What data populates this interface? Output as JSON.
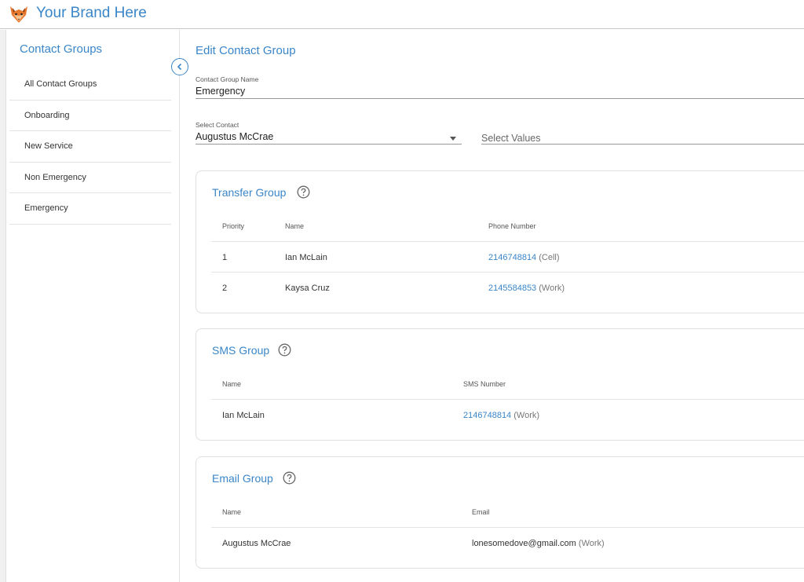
{
  "brand": {
    "name": "Your Brand Here",
    "logo_icon": "fox-icon"
  },
  "sidebar": {
    "title": "Contact Groups",
    "items": [
      {
        "label": "All Contact Groups"
      },
      {
        "label": "Onboarding"
      },
      {
        "label": "New Service"
      },
      {
        "label": "Non Emergency"
      },
      {
        "label": "Emergency"
      }
    ],
    "collapse_icon": "chevron-left-icon"
  },
  "main": {
    "title": "Edit Contact Group",
    "group_name": {
      "label": "Contact Group Name",
      "value": "Emergency"
    },
    "select_contact": {
      "label": "Select Contact",
      "value": "Augustus McCrae"
    },
    "select_values": {
      "placeholder": "Select Values"
    }
  },
  "transfer_group": {
    "title": "Transfer Group",
    "columns": {
      "priority": "Priority",
      "name": "Name",
      "phone": "Phone Number"
    },
    "rows": [
      {
        "priority": "1",
        "name": "Ian McLain",
        "number": "2146748814",
        "type": "(Cell)"
      },
      {
        "priority": "2",
        "name": "Kaysa Cruz",
        "number": "2145584853",
        "type": "(Work)"
      }
    ]
  },
  "sms_group": {
    "title": "SMS Group",
    "columns": {
      "name": "Name",
      "sms": "SMS Number"
    },
    "rows": [
      {
        "name": "Ian McLain",
        "number": "2146748814",
        "type": "(Work)"
      }
    ]
  },
  "email_group": {
    "title": "Email Group",
    "columns": {
      "name": "Name",
      "email": "Email"
    },
    "rows": [
      {
        "name": "Augustus McCrae",
        "email": "lonesomedove@gmail.com",
        "type": "(Work)"
      }
    ]
  },
  "colors": {
    "accent": "#3a86c8",
    "divider": "#e3e3e3"
  }
}
